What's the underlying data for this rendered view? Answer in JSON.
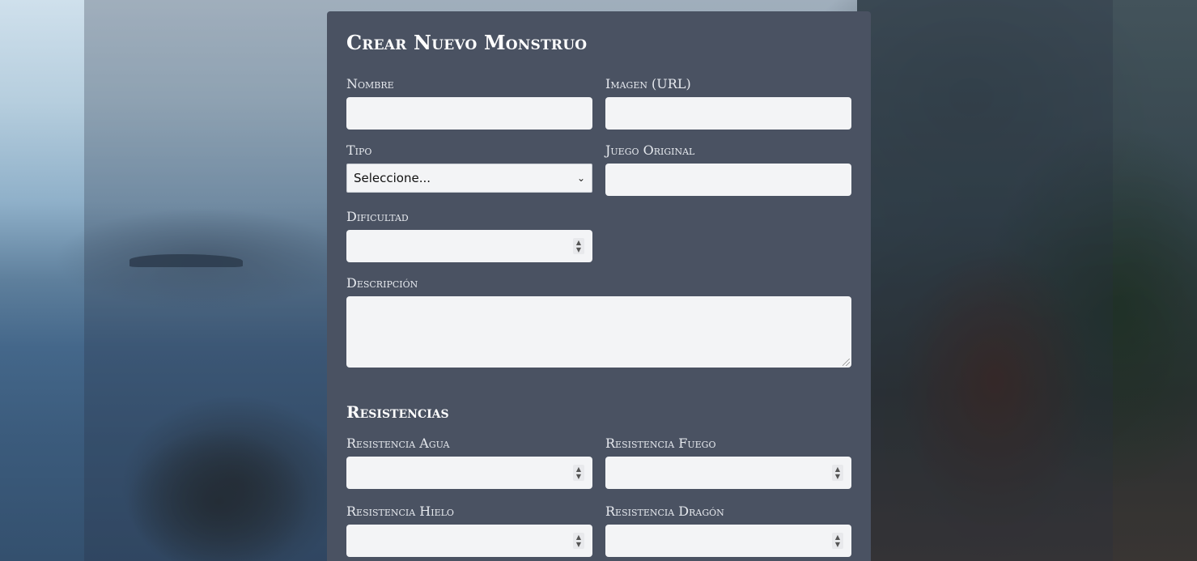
{
  "form": {
    "title": "Crear Nuevo Monstruo",
    "fields": {
      "nombre": {
        "label": "Nombre",
        "value": ""
      },
      "imagen": {
        "label": "Imagen (URL)",
        "value": ""
      },
      "tipo": {
        "label": "Tipo",
        "selected": "Seleccione..."
      },
      "juego": {
        "label": "Juego Original",
        "value": ""
      },
      "dificultad": {
        "label": "Dificultad",
        "value": ""
      },
      "descripcion": {
        "label": "Descripción",
        "value": ""
      }
    },
    "resistencias": {
      "title": "Resistencias",
      "agua": {
        "label": "Resistencia Agua",
        "value": ""
      },
      "fuego": {
        "label": "Resistencia Fuego",
        "value": ""
      },
      "hielo": {
        "label": "Resistencia Hielo",
        "value": ""
      },
      "dragon": {
        "label": "Resistencia Dragón",
        "value": ""
      }
    }
  },
  "icons": {
    "select_arrow": "chevron-down-icon",
    "spinner": "spinner-arrows-icon",
    "resize": "resize-grip-icon"
  },
  "colors": {
    "panel": "#4a5262",
    "input_bg": "#f3f4f6",
    "label_text": "#e6e9ee",
    "title_text": "#ffffff"
  }
}
